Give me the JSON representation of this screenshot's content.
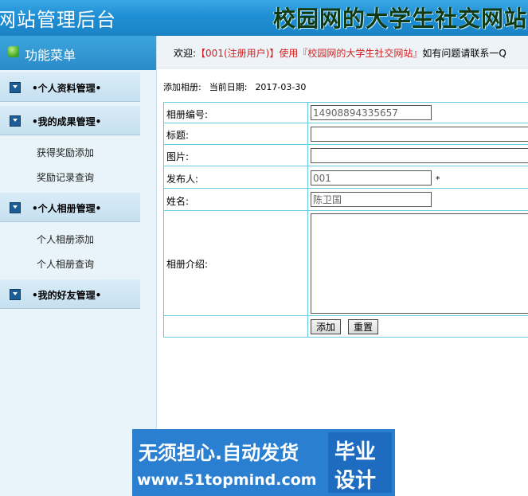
{
  "header": {
    "system_title": "网站管理后台",
    "site_title": "校园网的大学生社交网站"
  },
  "sidebar": {
    "title": "功能菜单",
    "groups": [
      {
        "label": "•个人资料管理•",
        "items": []
      },
      {
        "label": "•我的成果管理•",
        "items": [
          "获得奖励添加",
          "奖励记录查询"
        ]
      },
      {
        "label": "•个人相册管理•",
        "items": [
          "个人相册添加",
          "个人相册查询"
        ]
      },
      {
        "label": "•我的好友管理•",
        "items": []
      }
    ]
  },
  "welcome": {
    "prefix": "欢迎:",
    "user": "【001(注册用户)】",
    "use": "使用",
    "site": "『校园网的大学生社交网站』",
    "suffix": "如有问题请联系一Q"
  },
  "breadcrumb": {
    "page": "添加相册:",
    "date_label": "当前日期:",
    "date": "2017-03-30"
  },
  "form": {
    "album_id_label": "相册编号:",
    "album_id_value": "14908894335657",
    "title_label": "标题:",
    "title_value": "",
    "image_label": "图片:",
    "image_value": "",
    "publisher_label": "发布人:",
    "publisher_value": "001",
    "required_mark": "*",
    "name_label": "姓名:",
    "name_value": "陈卫国",
    "intro_label": "相册介绍:",
    "intro_value": "",
    "add_button": "添加",
    "reset_button": "重置"
  },
  "watermark": {
    "line1": "无须担心.自动发货",
    "line2": "www.51topmind.com",
    "box_top": "毕业",
    "box_bottom": "设计"
  },
  "colors": {
    "header_blue": "#1f8fd4",
    "table_border": "#69c9e0",
    "highlight_red": "#d22020"
  }
}
